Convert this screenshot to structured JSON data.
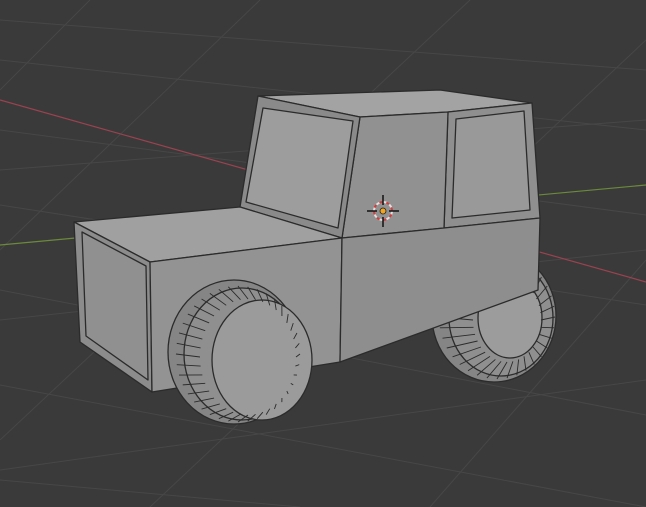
{
  "viewport": {
    "background": "#3a3a3a",
    "grid_color": "#454545",
    "x_axis_color": "#9b4250",
    "y_axis_color": "#6c8a3a",
    "mesh_fill_light": "#9a9a9a",
    "mesh_fill_mid": "#8d8d8d",
    "mesh_fill_dark": "#7e7e7e",
    "wire_color": "#2b2b2b",
    "cursor_color": "#e0e0e0",
    "cursor_ring_color": "#d63a3a",
    "origin_color": "#f2a51e"
  },
  "object": {
    "type": "car-mesh",
    "shading": "solid-with-wireframe"
  },
  "cursor": {
    "type": "3d-cursor"
  }
}
